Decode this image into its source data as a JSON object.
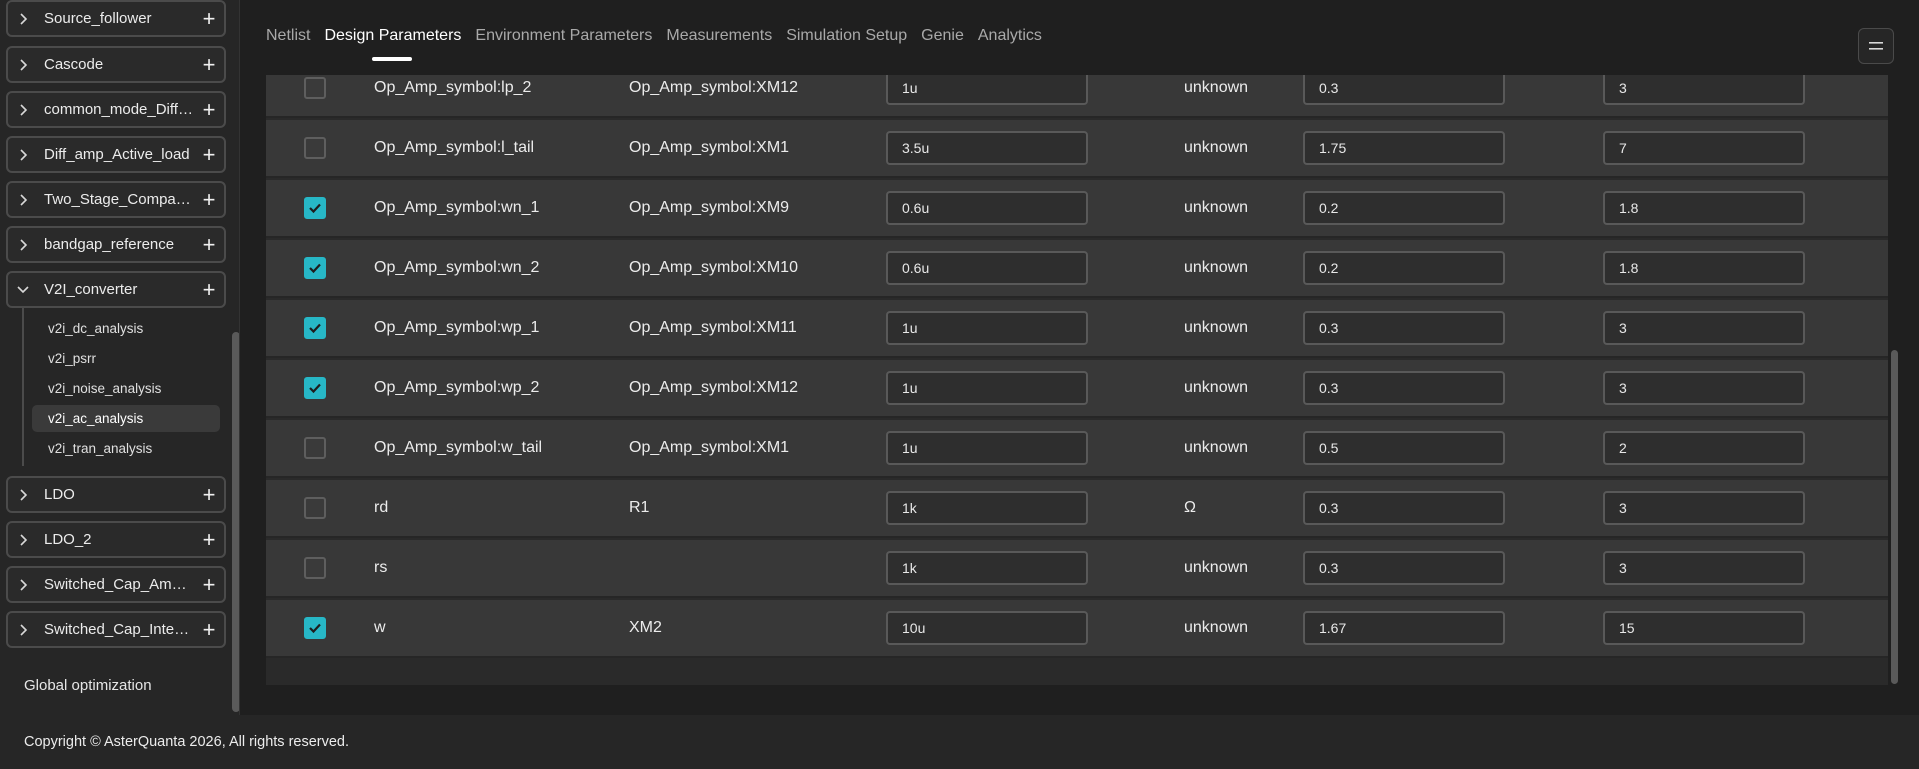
{
  "sidebar": {
    "projects": [
      {
        "name": "Source_follower",
        "expanded": false
      },
      {
        "name": "Cascode",
        "expanded": false
      },
      {
        "name": "common_mode_Diffa...",
        "expanded": false
      },
      {
        "name": "Diff_amp_Active_load",
        "expanded": false
      },
      {
        "name": "Two_Stage_Compara...",
        "expanded": false
      },
      {
        "name": "bandgap_reference",
        "expanded": false
      },
      {
        "name": "V2I_converter",
        "expanded": true
      },
      {
        "name": "LDO",
        "expanded": false
      },
      {
        "name": "LDO_2",
        "expanded": false
      },
      {
        "name": "Switched_Cap_Ampli...",
        "expanded": false
      },
      {
        "name": "Switched_Cap_Integr...",
        "expanded": false
      }
    ],
    "subitems": [
      {
        "label": "v2i_dc_analysis",
        "active": false
      },
      {
        "label": "v2i_psrr",
        "active": false
      },
      {
        "label": "v2i_noise_analysis",
        "active": false
      },
      {
        "label": "v2i_ac_analysis",
        "active": true
      },
      {
        "label": "v2i_tran_analysis",
        "active": false
      }
    ],
    "global_optimization": "Global optimization"
  },
  "tabs": [
    {
      "label": "Netlist",
      "active": false
    },
    {
      "label": "Design Parameters",
      "active": true
    },
    {
      "label": "Environment Parameters",
      "active": false
    },
    {
      "label": "Measurements",
      "active": false
    },
    {
      "label": "Simulation Setup",
      "active": false
    },
    {
      "label": "Genie",
      "active": false
    },
    {
      "label": "Analytics",
      "active": false
    }
  ],
  "table": {
    "rows": [
      {
        "checked": false,
        "name": "Op_Amp_symbol:lp_2",
        "instance": "Op_Amp_symbol:XM12",
        "value": "1u",
        "unit": "unknown",
        "min": "0.3",
        "max": "3"
      },
      {
        "checked": false,
        "name": "Op_Amp_symbol:l_tail",
        "instance": "Op_Amp_symbol:XM1",
        "value": "3.5u",
        "unit": "unknown",
        "min": "1.75",
        "max": "7"
      },
      {
        "checked": true,
        "name": "Op_Amp_symbol:wn_1",
        "instance": "Op_Amp_symbol:XM9",
        "value": "0.6u",
        "unit": "unknown",
        "min": "0.2",
        "max": "1.8"
      },
      {
        "checked": true,
        "name": "Op_Amp_symbol:wn_2",
        "instance": "Op_Amp_symbol:XM10",
        "value": "0.6u",
        "unit": "unknown",
        "min": "0.2",
        "max": "1.8"
      },
      {
        "checked": true,
        "name": "Op_Amp_symbol:wp_1",
        "instance": "Op_Amp_symbol:XM11",
        "value": "1u",
        "unit": "unknown",
        "min": "0.3",
        "max": "3"
      },
      {
        "checked": true,
        "name": "Op_Amp_symbol:wp_2",
        "instance": "Op_Amp_symbol:XM12",
        "value": "1u",
        "unit": "unknown",
        "min": "0.3",
        "max": "3"
      },
      {
        "checked": false,
        "name": "Op_Amp_symbol:w_tail",
        "instance": "Op_Amp_symbol:XM1",
        "value": "1u",
        "unit": "unknown",
        "min": "0.5",
        "max": "2"
      },
      {
        "checked": false,
        "name": "rd",
        "instance": "R1",
        "value": "1k",
        "unit": "Ω",
        "min": "0.3",
        "max": "3"
      },
      {
        "checked": false,
        "name": "rs",
        "instance": "",
        "value": "1k",
        "unit": "unknown",
        "min": "0.3",
        "max": "3"
      },
      {
        "checked": true,
        "name": "w",
        "instance": "XM2",
        "value": "10u",
        "unit": "unknown",
        "min": "1.67",
        "max": "15"
      }
    ]
  },
  "footer": {
    "copyright": "Copyright © AsterQuanta 2026, All rights reserved."
  },
  "colors": {
    "accent": "#27b7c6",
    "background": "#1f1f1f",
    "row": "#383838"
  }
}
